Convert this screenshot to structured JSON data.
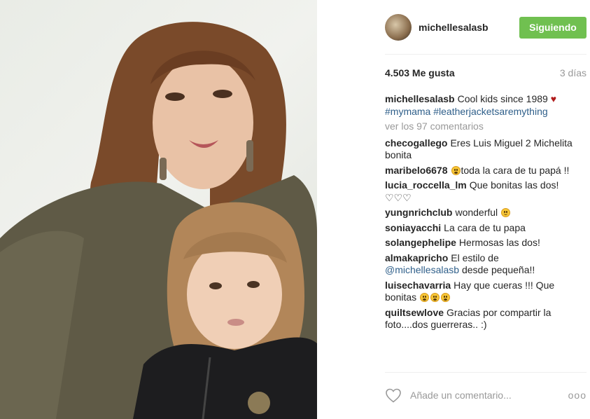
{
  "post": {
    "username": "michellesalasb",
    "follow_label": "Siguiendo",
    "likes": "4.503 Me gusta",
    "time": "3 días",
    "caption": {
      "user": "michellesalasb",
      "text": "Cool kids since 1989",
      "emoji": "♥",
      "hashtags": "#mymama #leatherjacketsaremything"
    },
    "view_all": "ver los 97 comentarios",
    "comments": [
      {
        "user": "checogallego",
        "text": "Eres Luis Miguel 2 Michelita bonita"
      },
      {
        "user": "maribelo6678",
        "text": "toda la cara de tu papá !!"
      },
      {
        "user": "lucia_roccella_lm",
        "text": "Que bonitas las dos! ♡♡♡"
      },
      {
        "user": "yungnrichclub",
        "text": "wonderful"
      },
      {
        "user": "soniayacchi",
        "text": "La cara de tu papa"
      },
      {
        "user": "solangephelipe",
        "text": "Hermosas las dos!"
      },
      {
        "user": "almakapricho",
        "text_before": "El estilo de",
        "mention": "@michellesalasb",
        "text_after": "desde pequeña!!"
      },
      {
        "user": "luisechavarria",
        "text": "Hay que cueras !!! Que bonitas"
      },
      {
        "user": "quiltsewlove",
        "text": "Gracias por compartir la foto....dos guerreras.. :)"
      }
    ],
    "comment_placeholder": "Añade un comentario...",
    "more_label": "ooo"
  },
  "colors": {
    "follow_button": "#70c050",
    "hashtag": "#2f5f8a",
    "muted": "#999999"
  },
  "icons": {
    "like": "heart-outline-icon",
    "more": "more-options-icon"
  }
}
